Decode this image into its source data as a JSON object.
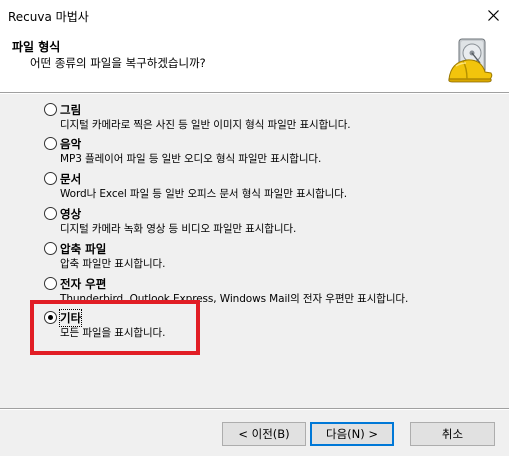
{
  "window": {
    "title": "Recuva 마법사",
    "close_icon": "close-icon"
  },
  "header": {
    "title": "파일 형식",
    "subtitle": "어떤 종류의 파일을 복구하겠습니까?",
    "logo_icon": "recuva-hardhat-drive-icon"
  },
  "options": [
    {
      "label": "그림",
      "description": "디지털 카메라로 찍은 사진 등 일반 이미지 형식 파일만 표시합니다.",
      "checked": false
    },
    {
      "label": "음악",
      "description": "MP3 플레이어 파일 등 일반 오디오 형식 파일만 표시합니다.",
      "checked": false
    },
    {
      "label": "문서",
      "description": "Word나 Excel 파일 등 일반 오피스 문서 형식 파일만 표시합니다.",
      "checked": false
    },
    {
      "label": "영상",
      "description": "디지털 카메라 녹화 영상 등 비디오 파일만 표시합니다.",
      "checked": false
    },
    {
      "label": "압축 파일",
      "description": "압축 파일만 표시합니다.",
      "checked": false
    },
    {
      "label": "전자 우편",
      "description": "Thunderbird, Outlook Express, Windows Mail의 전자 우편만 표시합니다.",
      "checked": false
    },
    {
      "label": "기타",
      "description": "모든 파일을 표시합니다.",
      "checked": true
    }
  ],
  "highlight_color": "#e11d25",
  "buttons": {
    "back": "< 이전(B)",
    "next": "다음(N) >",
    "cancel": "취소"
  }
}
